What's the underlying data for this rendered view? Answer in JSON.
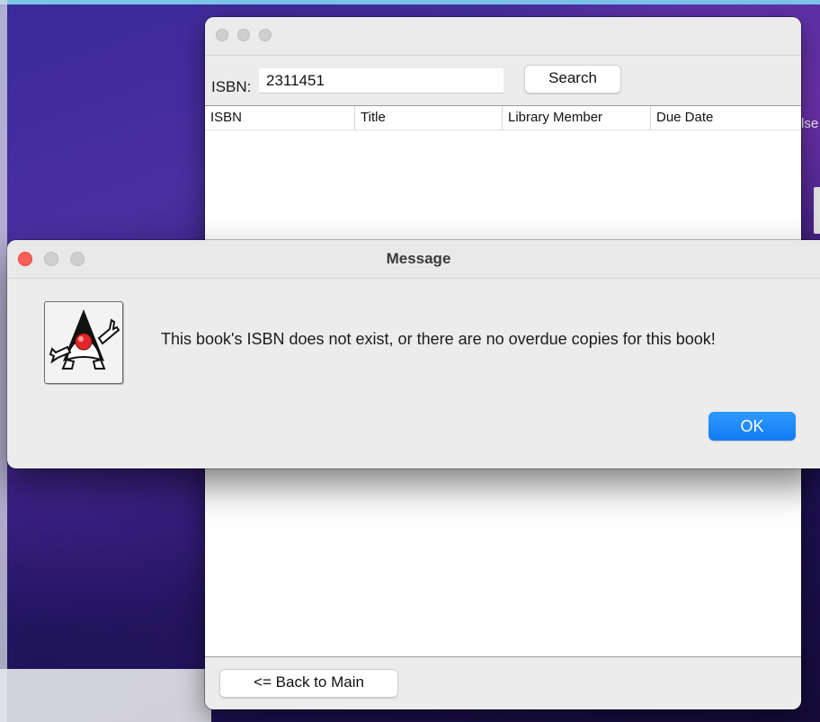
{
  "main_window": {
    "search": {
      "label": "ISBN:",
      "value": "2311451",
      "button_label": "Search"
    },
    "table": {
      "columns": [
        "ISBN",
        "Title",
        "Library Member",
        "Due Date"
      ],
      "rows": []
    },
    "back_button_label": "<= Back to Main"
  },
  "dialog": {
    "title": "Message",
    "icon": "java-duke-icon",
    "message": "This book's ISBN does not exist, or there are no overdue copies for this book!",
    "ok_label": "OK"
  },
  "background_peek": {
    "text": "lse"
  },
  "colors": {
    "ok_button": "#1f86f8",
    "close_button": "#fe5f57"
  }
}
